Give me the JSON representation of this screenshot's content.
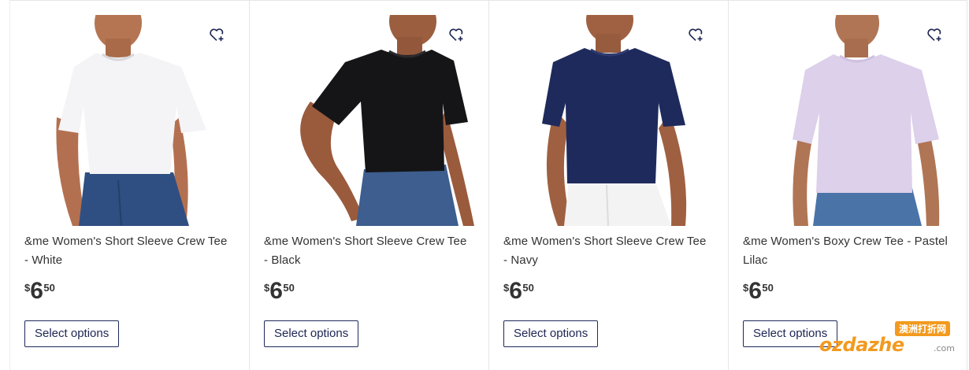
{
  "colors": {
    "brand_navy": "#1d2553",
    "text": "#333333",
    "border": "#e6e6e6",
    "watermark_orange": "#f29a1f"
  },
  "products": [
    {
      "title": "&me Women's Short Sleeve Crew Tee - White",
      "price_currency": "$",
      "price_dollars": "6",
      "price_cents": "50",
      "button_label": "Select options",
      "wishlist_icon": "heart-plus-icon",
      "shirt_color": "#f4f3f6",
      "pants_color": "#2f4f82"
    },
    {
      "title": "&me Women's Short Sleeve Crew Tee - Black",
      "price_currency": "$",
      "price_dollars": "6",
      "price_cents": "50",
      "button_label": "Select options",
      "wishlist_icon": "heart-plus-icon",
      "shirt_color": "#151518",
      "pants_color": "#3d5e8e"
    },
    {
      "title": "&me Women's Short Sleeve Crew Tee - Navy",
      "price_currency": "$",
      "price_dollars": "6",
      "price_cents": "50",
      "button_label": "Select options",
      "wishlist_icon": "heart-plus-icon",
      "shirt_color": "#1f2a5c",
      "pants_color": "#f3f3f4"
    },
    {
      "title": "&me Women's Boxy Crew Tee - Pastel Lilac",
      "price_currency": "$",
      "price_dollars": "6",
      "price_cents": "50",
      "button_label": "Select options",
      "wishlist_icon": "heart-plus-icon",
      "shirt_color": "#dcd0ea",
      "pants_color": "#4a74a8"
    }
  ],
  "watermark": {
    "top_text": "澳洲打折网",
    "main_text": "ozdazhe",
    "domain_text": ".com"
  }
}
